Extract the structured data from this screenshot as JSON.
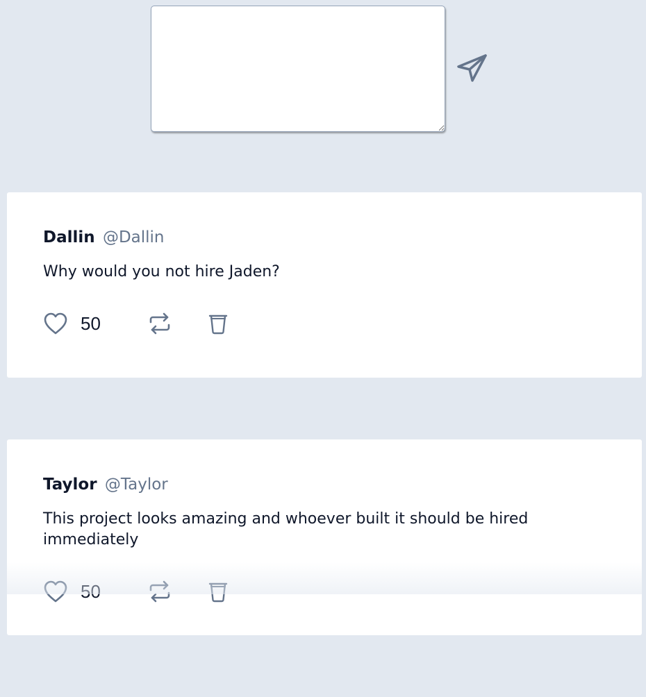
{
  "composer": {
    "value": "",
    "placeholder": ""
  },
  "send_button": {
    "icon": "send-icon",
    "color": "#64748b"
  },
  "tweets": [
    {
      "display_name": "Dallin",
      "handle": "@Dallin",
      "text": "Why would you not hire Jaden?",
      "likes": "50",
      "icons": [
        "heart-icon",
        "retweet-icon",
        "trash-icon"
      ]
    },
    {
      "display_name": "Taylor",
      "handle": "@Taylor",
      "text": "This project looks amazing and whoever built it should be hired immediately",
      "likes": "50",
      "icons": [
        "heart-icon",
        "retweet-icon",
        "trash-icon"
      ]
    }
  ],
  "colors": {
    "background": "#e2e8f0",
    "card": "#ffffff",
    "muted": "#64748b",
    "text": "#0f172a"
  }
}
